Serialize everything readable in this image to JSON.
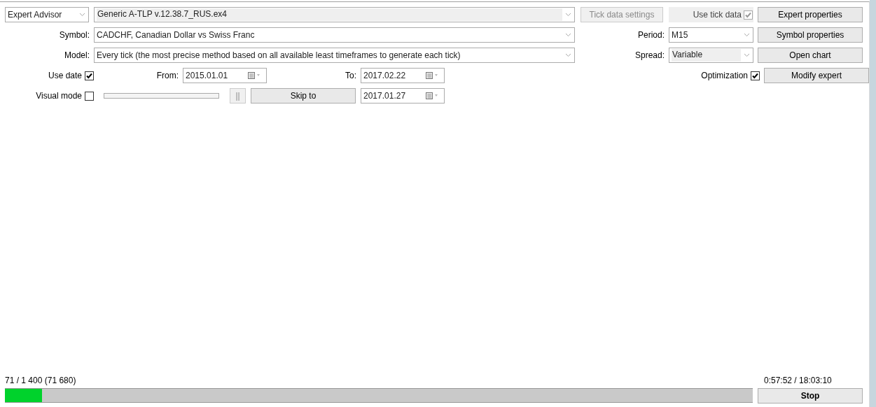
{
  "expert_type": {
    "value": "Expert Advisor"
  },
  "expert": {
    "value": "Generic A-TLP v.12.38.7_RUS.ex4",
    "disabled": true
  },
  "tick_data_settings": {
    "label": "Tick data settings",
    "disabled": true
  },
  "use_tick_data": {
    "label": "Use tick data",
    "checked": true,
    "disabled": true
  },
  "symbol": {
    "label": "Symbol:",
    "value": "CADCHF, Canadian Dollar vs Swiss Franc"
  },
  "period": {
    "label": "Period:",
    "value": "M15"
  },
  "model": {
    "label": "Model:",
    "value": "Every tick (the most precise method based on all available least timeframes to generate each tick)"
  },
  "spread": {
    "label": "Spread:",
    "value": "Variable",
    "disabled": true
  },
  "use_date": {
    "label": "Use date",
    "checked": true
  },
  "from": {
    "label": "From:",
    "value": "2015.01.01"
  },
  "to": {
    "label": "To:",
    "value": "2017.02.22"
  },
  "optimization": {
    "label": "Optimization",
    "checked": true
  },
  "visual_mode": {
    "label": "Visual mode",
    "checked": false
  },
  "pause_button": {
    "label": "||",
    "disabled": true
  },
  "skip_to": {
    "label": "Skip to",
    "disabled": false
  },
  "skip_date": {
    "value": "2017.01.27"
  },
  "side_buttons": [
    {
      "label": "Expert properties"
    },
    {
      "label": "Symbol properties"
    },
    {
      "label": "Open chart"
    },
    {
      "label": "Modify expert"
    }
  ],
  "progress": {
    "label": "71 / 1 400 (71 680)",
    "level": 0.05
  },
  "time": "0:57:52 / 18:03:10",
  "stop_button": {
    "label": "Stop"
  }
}
